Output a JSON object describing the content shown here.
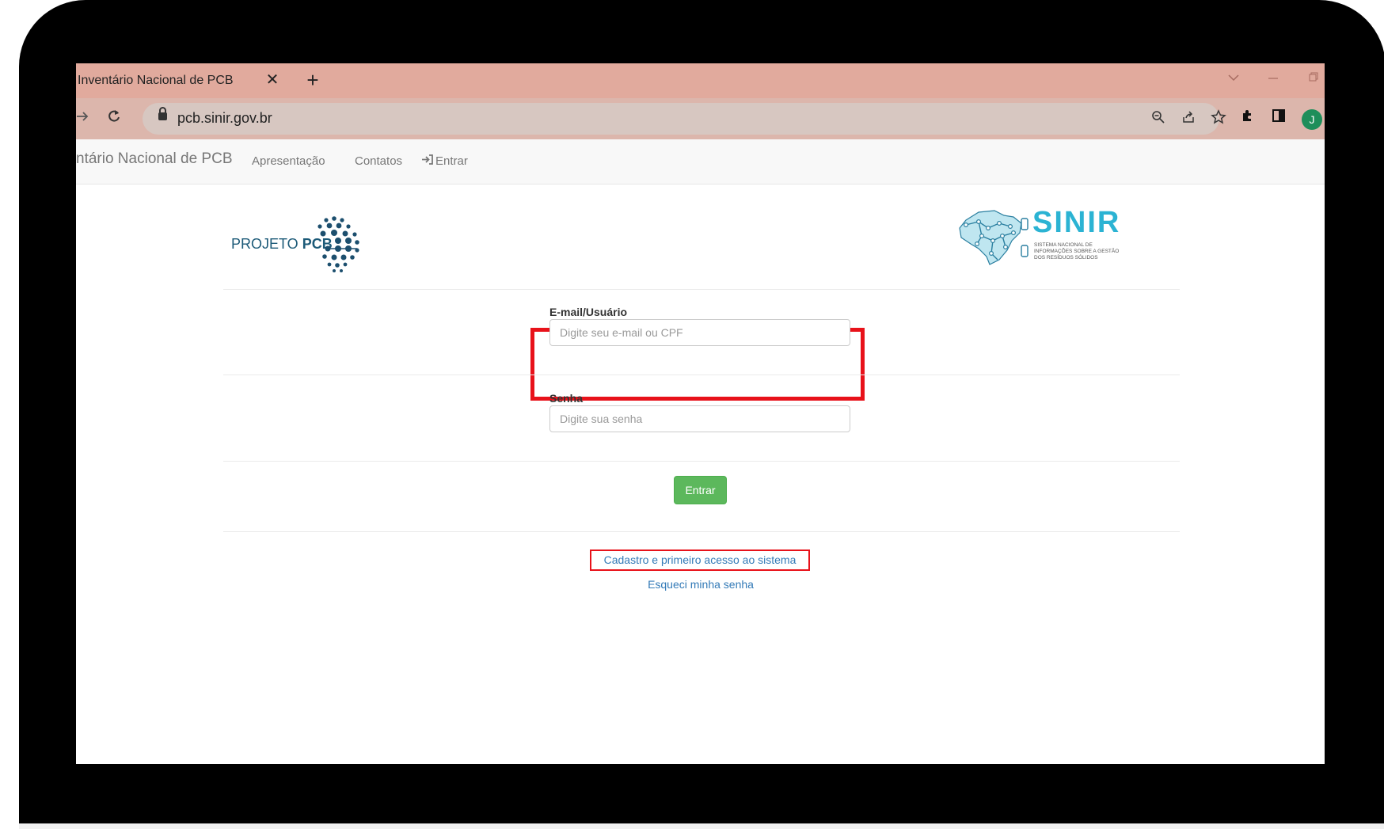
{
  "browser": {
    "tab_title": "Inventário Nacional de PCB",
    "tab_close_glyph": "✕",
    "new_tab_glyph": "+",
    "url": "pcb.sinir.gov.br",
    "profile_initial": "J",
    "tab_strip_color": "#e1aa9d"
  },
  "navbar": {
    "brand": "ntário Nacional de PCB",
    "links": [
      "Apresentação",
      "Contatos"
    ],
    "signin_label": "Entrar"
  },
  "logos": {
    "pcb_text_prefix": "PROJETO ",
    "pcb_text_bold": "PCB",
    "sinir_word": "SINIR",
    "sinir_tagline": "Sistema Nacional de Informações sobre a Gestão dos Resíduos Sólidos",
    "sinir_color": "#2bb3d3"
  },
  "form": {
    "email_label": "E-mail/Usuário",
    "email_placeholder": "Digite seu e-mail ou CPF",
    "email_value": "",
    "password_label": "Senha",
    "password_placeholder": "Digite sua senha",
    "password_value": "",
    "submit_label": "Entrar",
    "submit_color": "#5cb85c",
    "highlight_color": "#e8121a"
  },
  "links": {
    "register": "Cadastro e primeiro acesso ao sistema",
    "forgot": "Esqueci minha senha",
    "link_color": "#337ab7"
  }
}
